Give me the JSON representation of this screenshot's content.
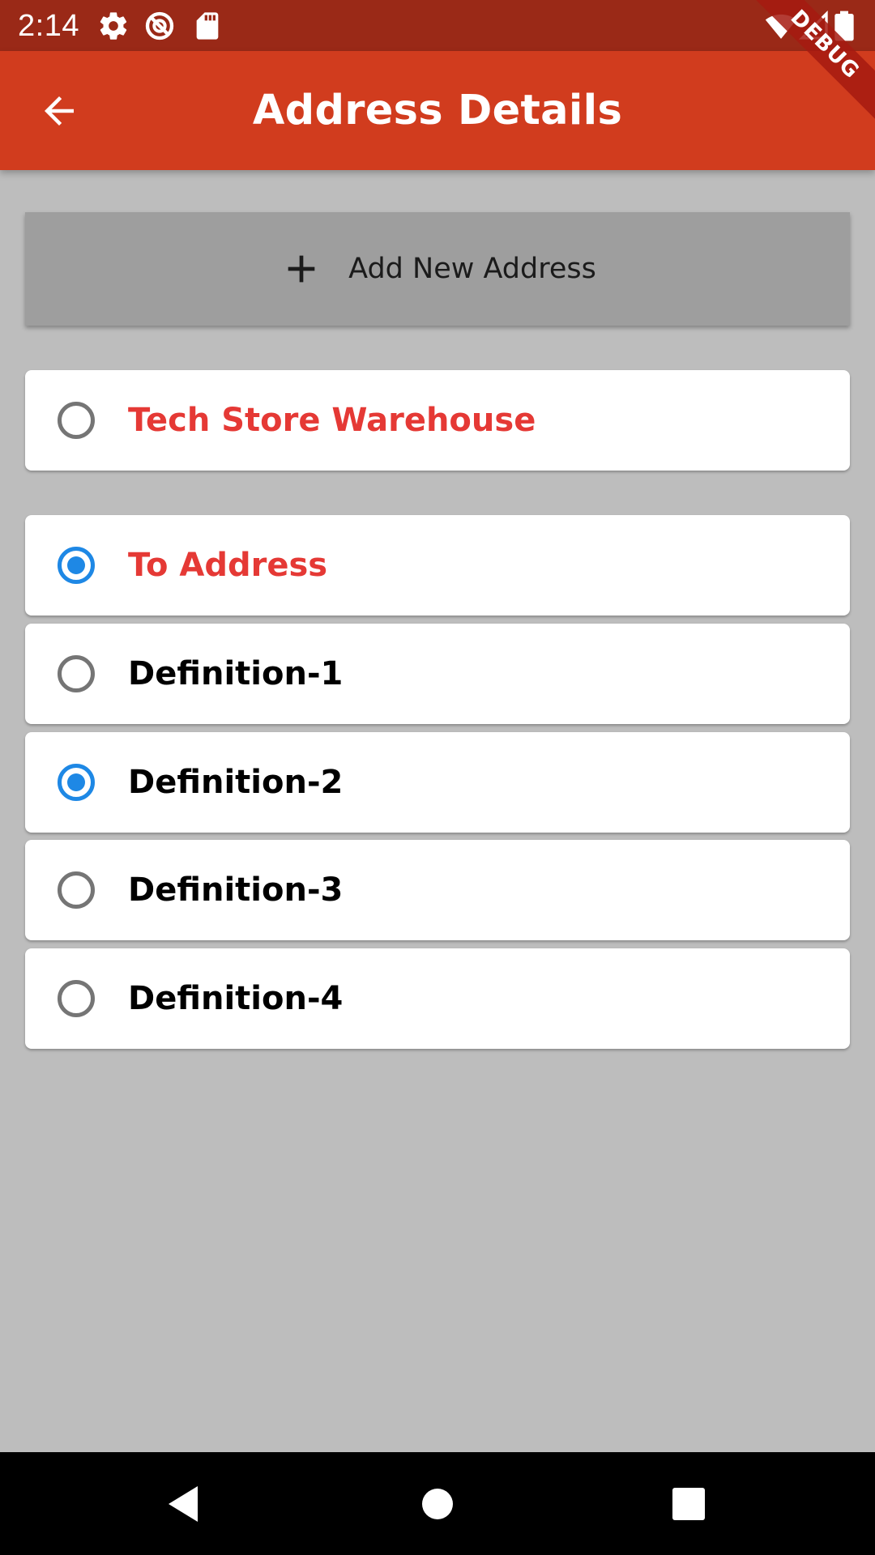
{
  "status_bar": {
    "time": "2:14",
    "left_icons": [
      "settings-icon",
      "sync-icon",
      "sd-card-icon"
    ],
    "right_icons": [
      "wifi-icon",
      "signal-icon",
      "battery-icon"
    ]
  },
  "debug_banner": {
    "label": "DEBUG"
  },
  "app_bar": {
    "title": "Address Details",
    "back_icon": "arrow-back-icon",
    "background": "#D13C1E"
  },
  "add_address": {
    "label": "Add New Address",
    "icon": "plus-icon"
  },
  "warehouse": {
    "label": "Tech Store Warehouse",
    "selected": false
  },
  "to_address": {
    "label": "To Address",
    "selected": true
  },
  "definitions": [
    {
      "label": "Definition-1",
      "selected": false
    },
    {
      "label": "Definition-2",
      "selected": true
    },
    {
      "label": "Definition-3",
      "selected": false
    },
    {
      "label": "Definition-4",
      "selected": false
    }
  ],
  "nav_bar": {
    "buttons": [
      "back-triangle-icon",
      "home-circle-icon",
      "recents-square-icon"
    ]
  },
  "colors": {
    "accent_text": "#E53935",
    "radio_selected": "#1E88E5",
    "radio_unselected": "#757575",
    "screen_background": "#BDBDBD"
  }
}
